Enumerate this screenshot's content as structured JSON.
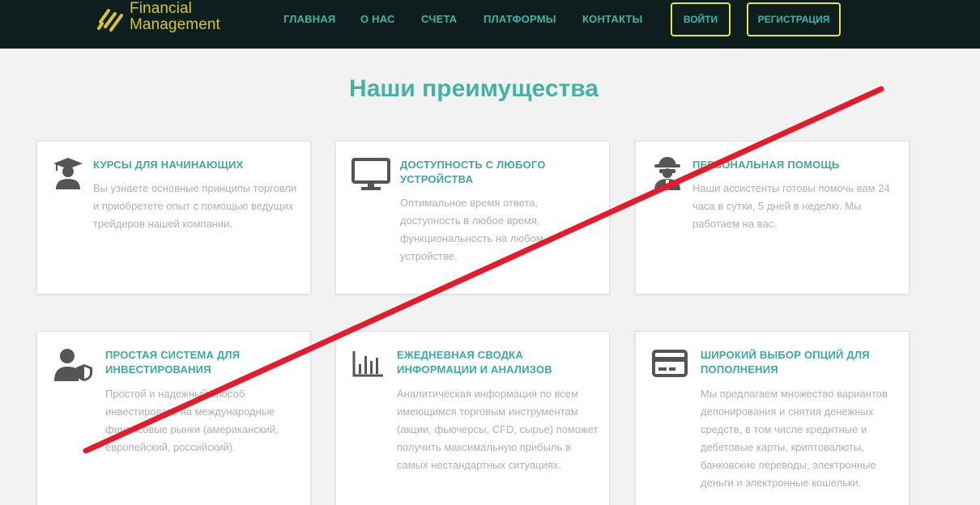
{
  "brand": {
    "line1": "Financial",
    "line2": "Management"
  },
  "nav": [
    "ГЛАВНАЯ",
    "О НАС",
    "СЧЕТА",
    "ПЛАТФОРМЫ",
    "КОНТАКТЫ"
  ],
  "buttons": {
    "login": "ВОЙТИ",
    "register": "РЕГИСТРАЦИЯ"
  },
  "section_title": "Наши преимущества",
  "colors": {
    "accent": "#45b3a4",
    "brand_yellow": "#d7c52f",
    "header_bg": "#0d1e1d",
    "strike_red": "#e31b2b"
  },
  "cards": [
    {
      "icon": "graduate-icon",
      "title": "КУРСЫ ДЛЯ НАЧИНАЮЩИХ",
      "text": "Вы узнаете основные принципы торговли и приобретете опыт с помощью ведущих трейдеров нашей компании."
    },
    {
      "icon": "monitor-icon",
      "title": "ДОСТУПНОСТЬ С ЛЮБОГО УСТРОЙСТВА",
      "text": "Оптимальное время ответа, доступность в любое время, функциональность на любом устройстве."
    },
    {
      "icon": "agent-icon",
      "title": "ПЕРСОНАЛЬНАЯ ПОМОЩЬ",
      "text": "Наши ассистенты готовы помочь вам 24 часа в сутки, 5 дней в неделю. Мы работаем на вас."
    },
    {
      "icon": "user-shield-icon",
      "title": "ПРОСТАЯ СИСТЕМА ДЛЯ ИНВЕСТИРОВАНИЯ",
      "text": "Простой и надежный способ инвестировать на международные финансовые рынки (американский, европейский, российский)."
    },
    {
      "icon": "bar-chart-icon",
      "title": "ЕЖЕДНЕВНАЯ СВОДКА ИНФОРМАЦИИ И АНАЛИЗОВ",
      "text": "Аналитическая информация по всем имеющимся торговым инструментам (акции, фьючерсы, CFD, сырье) поможет получить максимальную прибыль в самых нестандартных ситуациях."
    },
    {
      "icon": "credit-card-icon",
      "title": "ШИРОКИЙ ВЫБОР ОПЦИЙ ДЛЯ ПОПОЛНЕНИЯ",
      "text": "Мы предлагаем множество вариантов депонирования и снятия денежных средств, в том числе кредитные и дебетовые карты, криптовалюты, банковские переводы, электронные деньги и электронные кошельки."
    }
  ]
}
